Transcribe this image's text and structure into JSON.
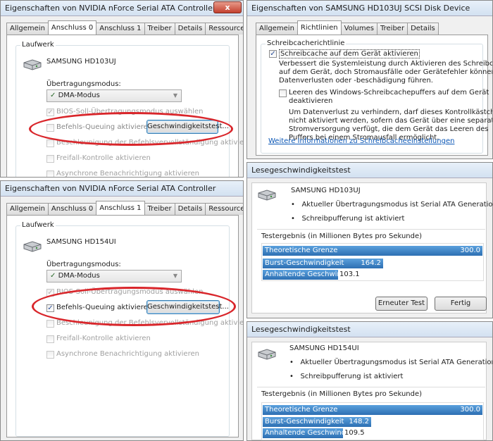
{
  "w1": {
    "title": "Eigenschaften von NVIDIA nForce Serial ATA Controller",
    "close": "x",
    "tabs": [
      "Allgemein",
      "Anschluss 0",
      "Anschluss 1",
      "Treiber",
      "Details",
      "Ressourcen"
    ],
    "group_title": "Laufwerk",
    "drive_name": "SAMSUNG HD103UJ",
    "mode_label": "Übertragungsmodus:",
    "mode_value": "DMA-Modus",
    "bios_label": "BIOS-Soll-Übertragungsmodus auswählen",
    "ncq_label": "Befehls-Queuing aktivieren",
    "speed_btn": "Geschwindigkeitstest...",
    "cmd_label": "Beschleunigung der Befehlsvervollständigung aktivieren",
    "freifall_label": "Freifall-Kontrolle aktivieren",
    "async_label": "Asynchrone Benachrichtigung aktivieren"
  },
  "w2": {
    "title": "Eigenschaften von SAMSUNG HD103UJ SCSI Disk Device",
    "tabs": [
      "Allgemein",
      "Richtlinien",
      "Volumes",
      "Treiber",
      "Details"
    ],
    "group_title": "Schreibcacherichtlinie",
    "cache_label": "Schreibcache auf dem Gerät aktivieren",
    "cache_desc": [
      "Verbessert die Systemleistung durch Aktivieren des Schreibcaches",
      "auf dem Gerät, doch Stromausfälle oder Gerätefehler können zu",
      "Datenverlusten oder -beschädigung führen."
    ],
    "flush_label": [
      "Leeren des Windows-Schreibcachepuffers auf dem Gerät",
      "deaktivieren"
    ],
    "flush_desc": [
      "Um Datenverlust zu verhindern, darf dieses Kontrollkästchen",
      "nicht aktiviert werden, sofern das Gerät über eine separate",
      "Stromversorgung verfügt, die dem Gerät das Leeren des",
      "Puffers bei einem Stromausfall ermöglicht."
    ],
    "link": "Weitere Informationen zu Schreibcacheeinstellungen"
  },
  "w3": {
    "title": "Eigenschaften von NVIDIA nForce Serial ATA Controller",
    "tabs": [
      "Allgemein",
      "Anschluss 0",
      "Anschluss 1",
      "Treiber",
      "Details",
      "Ressourcen"
    ],
    "group_title": "Laufwerk",
    "drive_name": "SAMSUNG HD154UI",
    "mode_label": "Übertragungsmodus:",
    "mode_value": "DMA-Modus",
    "bios_label": "BIOS-Soll-Übertragungsmodus auswählen",
    "ncq_label": "Befehls-Queuing aktivieren",
    "speed_btn": "Geschwindigkeitstest...",
    "cmd_label": "Beschleunigung der Befehlsvervollständigung aktivieren",
    "freifall_label": "Freifall-Kontrolle aktivieren",
    "async_label": "Asynchrone Benachrichtigung aktivieren"
  },
  "w4": {
    "title": "Lesegeschwindigkeitstest",
    "drive_name": "SAMSUNG HD103UJ",
    "info1": "Aktueller Übertragungsmodus ist Serial ATA Generation 2 –3G",
    "info2": "Schreibpufferung ist aktiviert",
    "result_label": "Testergebnis (in Millionen Bytes pro Sekunde)",
    "bars": [
      {
        "label": "Theoretische Grenze",
        "value": "300.0",
        "fraction": 1.0
      },
      {
        "label": "Burst-Geschwindigkeit",
        "value": "164.2",
        "fraction": 0.547
      },
      {
        "label": "Anhaltende Geschwindigkeit",
        "value": "103.1",
        "fraction": 0.344
      }
    ],
    "retest": "Erneuter Test",
    "done": "Fertig"
  },
  "w5": {
    "title": "Lesegeschwindigkeitstest",
    "drive_name": "SAMSUNG HD154UI",
    "info1": "Aktueller Übertragungsmodus ist Serial ATA Generation 2 –3G",
    "info2": "Schreibpufferung ist aktiviert",
    "result_label": "Testergebnis (in Millionen Bytes pro Sekunde)",
    "bars": [
      {
        "label": "Theoretische Grenze",
        "value": "300.0",
        "fraction": 1.0
      },
      {
        "label": "Burst-Geschwindigkeit",
        "value": "148.2",
        "fraction": 0.494
      },
      {
        "label": "Anhaltende Geschwindigkeit",
        "value": "109.5",
        "fraction": 0.365
      }
    ]
  },
  "colors": {
    "bar": "#3d7fc4",
    "highlight": "#d9262b",
    "link": "#0b57b6"
  }
}
